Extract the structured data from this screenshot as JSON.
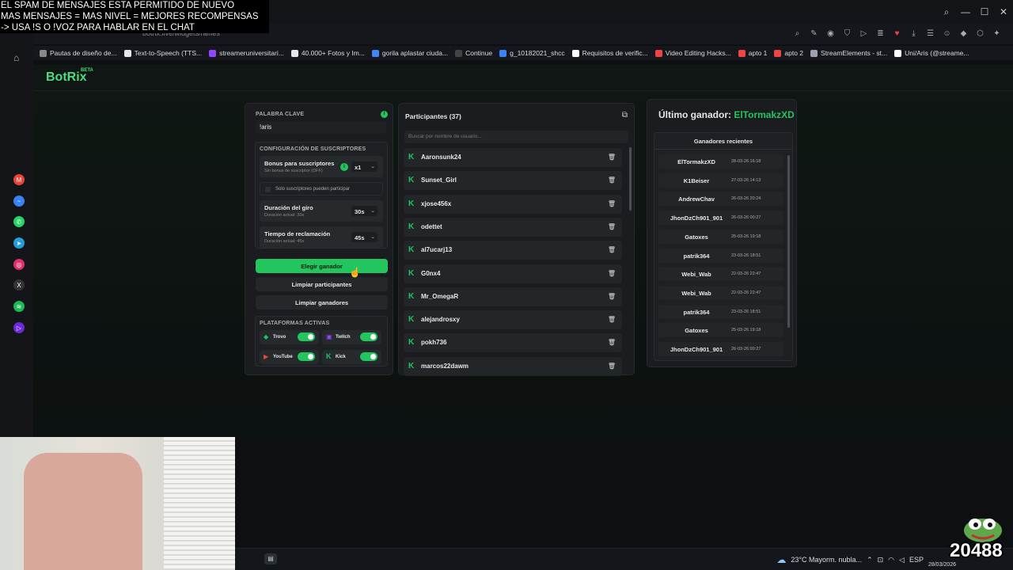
{
  "overlay": {
    "line1": "EL SPAM DE MENSAJES ESTA PERMITIDO DE NUEVO",
    "line2": "MAS MENSAJES = MAS NIVEL = MEJORES RECOMPENSAS",
    "line3": "-> USA !S  O !VOZ PARA HABLAR EN EL CHAT"
  },
  "browser": {
    "url": "botrix.live/widgets/raffles",
    "bookmarks": [
      {
        "label": "Pautas de diseño de...",
        "color": "#888888"
      },
      {
        "label": "Text-to-Speech (TTS...",
        "color": "#e5e7eb"
      },
      {
        "label": "streameruniversitari...",
        "color": "#9146ff"
      },
      {
        "label": "40.000+ Fotos y Im...",
        "color": "#e5e7eb"
      },
      {
        "label": "gorila aplastar ciuda...",
        "color": "#4285f4"
      },
      {
        "label": "Continue",
        "color": "#444444"
      },
      {
        "label": "g_10182021_shcc",
        "color": "#3b82f6"
      },
      {
        "label": "Requisitos de verific...",
        "color": "#ffffff"
      },
      {
        "label": "Video Editing Hacks...",
        "color": "#ef4444"
      },
      {
        "label": "apto 1",
        "color": "#ef4444"
      },
      {
        "label": "apto 2",
        "color": "#ef4444"
      },
      {
        "label": "StreamElements - st...",
        "color": "#9ca3af"
      },
      {
        "label": "Uni/Aris (@streame...",
        "color": "#ffffff"
      }
    ]
  },
  "app": {
    "logo": "BotRix",
    "logo_badge": "BETA"
  },
  "keyword": {
    "label": "PALABRA CLAVE",
    "value": "!aris"
  },
  "subs": {
    "section_label": "CONFIGURACIÓN DE SUSCRIPTORES",
    "bonus_title": "Bonus para suscriptores",
    "bonus_sub": "Sin bonus de suscriptor (OFF)",
    "bonus_value": "x1",
    "only_subs": "Solo suscriptores pueden participar",
    "spin_title": "Duración del giro",
    "spin_sub": "Duración actual: 30s",
    "spin_value": "30s",
    "claim_title": "Tiempo de reclamación",
    "claim_sub": "Duración actual: 45s",
    "claim_value": "45s"
  },
  "buttons": {
    "pick": "Elegir ganador",
    "clear_participants": "Limpiar participantes",
    "clear_winners": "Limpiar ganadores"
  },
  "platforms": {
    "label": "PLATAFORMAS ACTIVAS",
    "items": [
      "Trovo",
      "Twitch",
      "YouTube",
      "Kick"
    ]
  },
  "participants": {
    "title": "Participantes (37)",
    "search_placeholder": "Buscar por nombre de usuario...",
    "names": [
      "Aaronsunk24",
      "Sunset_Girl",
      "xjose456x",
      "odettet",
      "al7ucarj13",
      "G0nx4",
      "Mr_OmegaR",
      "alejandrosxy",
      "pokh736",
      "marcos22dawm"
    ]
  },
  "winners": {
    "last_label": "Último ganador:",
    "last_name": "ElTormakzXD",
    "recent_label": "Ganadores recientes",
    "items": [
      {
        "name": "ElTormakzXD",
        "date": "28-03-26 16:18"
      },
      {
        "name": "K1Beiser",
        "date": "27-03-26 14:13"
      },
      {
        "name": "AndrewChav",
        "date": "26-03-26 20:24"
      },
      {
        "name": "JhonDzCh901_901",
        "date": "26-03-26 00:27"
      },
      {
        "name": "Gatoxes",
        "date": "25-03-26 19:18"
      },
      {
        "name": "patrik364",
        "date": "23-03-26 18:51"
      },
      {
        "name": "Webi_Wab",
        "date": "22-03-26 22:47"
      },
      {
        "name": "Webi_Wab",
        "date": "22-03-26 22:47"
      },
      {
        "name": "patrik364",
        "date": "23-03-26 18:51"
      },
      {
        "name": "Gatoxes",
        "date": "25-03-26 19:18"
      },
      {
        "name": "JhonDzCh901_901",
        "date": "26-03-26 00:27"
      }
    ]
  },
  "taskbar": {
    "weather": "23°C  Mayorm. nubla...",
    "lang": "ESP",
    "date": "28/03/2026",
    "overlay_number": "20488"
  },
  "colors": {
    "accent": "#22c55e",
    "panel": "#1a1c1f"
  }
}
